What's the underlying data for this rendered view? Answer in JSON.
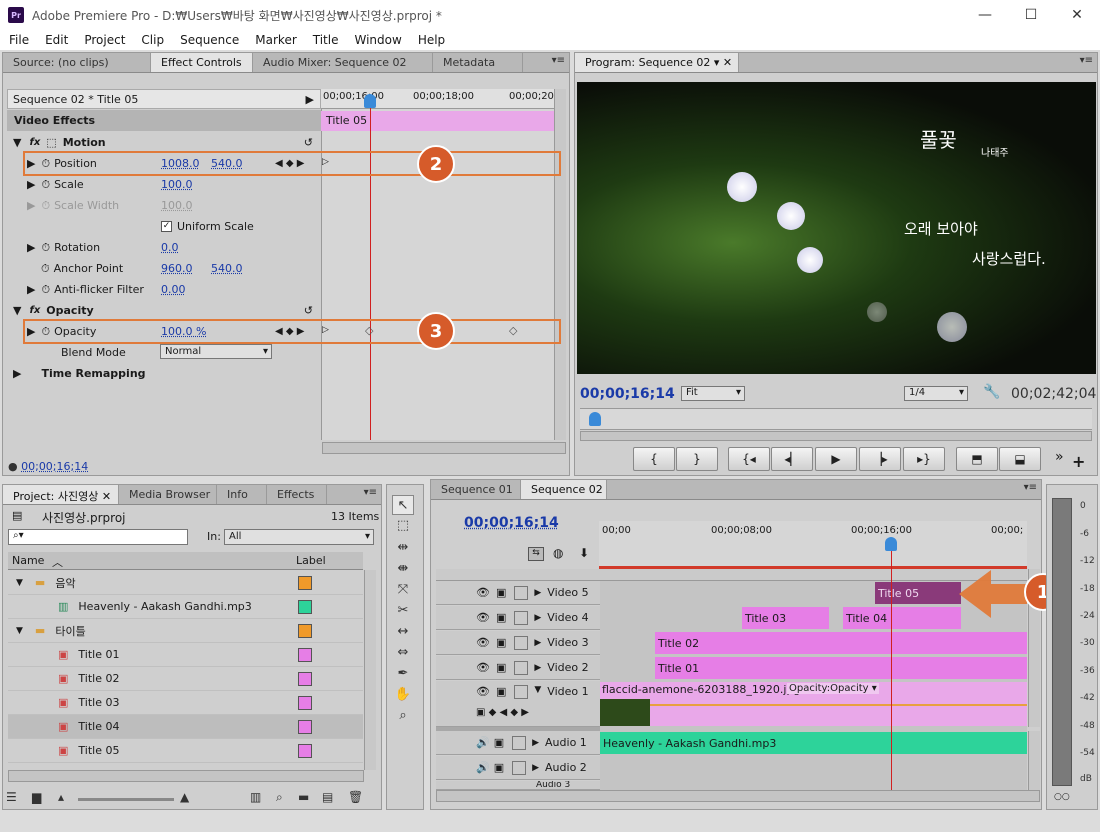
{
  "window": {
    "title": "Adobe Premiere Pro - D:₩Users₩바탕 화면₩사진영상₩사진영상.prproj *",
    "logo": "Pr"
  },
  "menu": [
    "File",
    "Edit",
    "Project",
    "Clip",
    "Sequence",
    "Marker",
    "Title",
    "Window",
    "Help"
  ],
  "effect_panel": {
    "tabs": [
      "Source: (no clips)",
      "Effect Controls",
      "Audio Mixer: Sequence 02",
      "Metadata"
    ],
    "sequence_label": "Sequence 02 * Title 05",
    "ruler": [
      "00;00;16;00",
      "00;00;18;00",
      "00;00;20"
    ],
    "clip_label": "Title 05",
    "section": "Video Effects",
    "motion": "Motion",
    "position": {
      "label": "Position",
      "x": "1008.0",
      "y": "540.0"
    },
    "scale": {
      "label": "Scale",
      "value": "100.0"
    },
    "scale_width": {
      "label": "Scale Width",
      "value": "100.0"
    },
    "uniform": "Uniform Scale",
    "rotation": {
      "label": "Rotation",
      "value": "0.0"
    },
    "anchor": {
      "label": "Anchor Point",
      "x": "960.0",
      "y": "540.0"
    },
    "antiflicker": {
      "label": "Anti-flicker Filter",
      "value": "0.00"
    },
    "opacity_group": "Opacity",
    "opacity": {
      "label": "Opacity",
      "value": "100.0 %"
    },
    "blend": {
      "label": "Blend Mode",
      "value": "Normal"
    },
    "time_remap": "Time Remapping",
    "timecode": "00;00;16;14"
  },
  "program": {
    "tab": "Program: Sequence 02",
    "overlay_title": "풀꽃",
    "overlay_author": "나태주",
    "overlay_line1": "오래 보아야",
    "overlay_line2": "사랑스럽다.",
    "timecode": "00;00;16;14",
    "fit": "Fit",
    "res": "1/4",
    "duration": "00;02;42;04"
  },
  "project": {
    "tabs": [
      "Project: 사진영상",
      "Media Browser",
      "Info",
      "Effects"
    ],
    "file": "사진영상.prproj",
    "items_count": "13 Items",
    "search_placeholder": "",
    "in_label": "In:",
    "in_value": "All",
    "col_name": "Name",
    "col_label": "Label",
    "rows": [
      {
        "name": "음악",
        "color": "#f09a2a"
      },
      {
        "name": "Heavenly - Aakash Gandhi.mp3",
        "color": "#2dd39a"
      },
      {
        "name": "타이틀",
        "color": "#f09a2a"
      },
      {
        "name": "Title 01",
        "color": "#e67ee6"
      },
      {
        "name": "Title 02",
        "color": "#e67ee6"
      },
      {
        "name": "Title 03",
        "color": "#e67ee6"
      },
      {
        "name": "Title 04",
        "color": "#e67ee6"
      },
      {
        "name": "Title 05",
        "color": "#e67ee6"
      }
    ]
  },
  "timeline": {
    "tabs": [
      "Sequence 01",
      "Sequence 02"
    ],
    "timecode": "00;00;16;14",
    "ruler": [
      "00;00",
      "00;00;08;00",
      "00;00;16;00",
      "00;00;"
    ],
    "tracks": [
      "Video 5",
      "Video 4",
      "Video 3",
      "Video 2",
      "Video 1",
      "Audio 1",
      "Audio 2",
      "Audio 3"
    ],
    "clips": {
      "t05": "Title 05",
      "t03": "Title 03",
      "t04": "Title 04",
      "t02": "Title 02",
      "t01": "Title 01",
      "img": "flaccid-anemone-6203188_1920.jpg",
      "img_fx": "Opacity:Opacity",
      "audio": "Heavenly - Aakash Gandhi.mp3"
    }
  },
  "meter": [
    "0",
    "-6",
    "-12",
    "-18",
    "-24",
    "-30",
    "-36",
    "-42",
    "-48",
    "-54",
    "dB"
  ],
  "badges": [
    "1",
    "2",
    "3"
  ],
  "colors": {
    "title_clip": "#e67ee6",
    "title_clip_selected": "#8a3a7a",
    "audio_clip": "#2dd39a",
    "accent": "#d65b2a",
    "timecode": "#1a3aa8",
    "playhead": "#d02020"
  }
}
